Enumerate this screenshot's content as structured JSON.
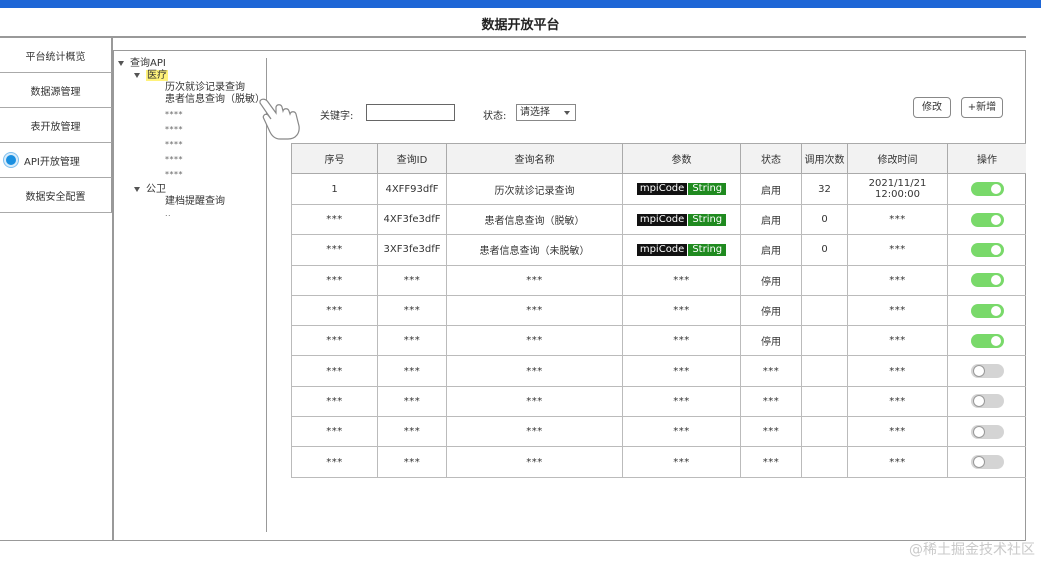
{
  "app": {
    "title": "数据开放平台"
  },
  "sidebar": {
    "items": [
      {
        "label": "平台统计概览",
        "active": false
      },
      {
        "label": "数据源管理",
        "active": false
      },
      {
        "label": "表开放管理",
        "active": false
      },
      {
        "label": "API开放管理",
        "active": true
      },
      {
        "label": "数据安全配置",
        "active": false
      }
    ]
  },
  "tree": {
    "root": "查询API",
    "group1": {
      "label": "医疗",
      "items": [
        "历次就诊记录查询",
        "患者信息查询（脱敏）",
        "****",
        "****",
        "****",
        "****",
        "****"
      ]
    },
    "group2": {
      "label": "公卫",
      "items": [
        "建档提醒查询",
        ".."
      ]
    }
  },
  "filters": {
    "keyword_label": "关键字:",
    "keyword_value": "",
    "status_label": "状态:",
    "status_value": "请选择"
  },
  "buttons": {
    "edit": "修改",
    "add": "+新增"
  },
  "table": {
    "headers": [
      "序号",
      "查询ID",
      "查询名称",
      "参数",
      "状态",
      "调用次数",
      "修改时间",
      "操作"
    ],
    "rows": [
      {
        "seq": "1",
        "id": "4XFF93dfF",
        "name": "历次就诊记录查询",
        "param_key": "mpiCode",
        "param_type": "String",
        "status": "启用",
        "calls": "32",
        "time": "2021/11/21 12:00:00",
        "enabled": true
      },
      {
        "seq": "***",
        "id": "4XF3fe3dfF",
        "name": "患者信息查询（脱敏）",
        "param_key": "mpiCode",
        "param_type": "String",
        "status": "启用",
        "calls": "0",
        "time": "***",
        "enabled": true
      },
      {
        "seq": "***",
        "id": "3XF3fe3dfF",
        "name": "患者信息查询（未脱敏）",
        "param_key": "mpiCode",
        "param_type": "String",
        "status": "启用",
        "calls": "0",
        "time": "***",
        "enabled": true
      },
      {
        "seq": "***",
        "id": "***",
        "name": "***",
        "param_key": "",
        "param_type": "",
        "param_text": "***",
        "status": "停用",
        "calls": "",
        "time": "***",
        "enabled": true
      },
      {
        "seq": "***",
        "id": "***",
        "name": "***",
        "param_key": "",
        "param_type": "",
        "param_text": "***",
        "status": "停用",
        "calls": "",
        "time": "***",
        "enabled": true
      },
      {
        "seq": "***",
        "id": "***",
        "name": "***",
        "param_key": "",
        "param_type": "",
        "param_text": "***",
        "status": "停用",
        "calls": "",
        "time": "***",
        "enabled": true
      },
      {
        "seq": "***",
        "id": "***",
        "name": "***",
        "param_key": "",
        "param_type": "",
        "param_text": "***",
        "status": "***",
        "calls": "",
        "time": "***",
        "enabled": false
      },
      {
        "seq": "***",
        "id": "***",
        "name": "***",
        "param_key": "",
        "param_type": "",
        "param_text": "***",
        "status": "***",
        "calls": "",
        "time": "***",
        "enabled": false
      },
      {
        "seq": "***",
        "id": "***",
        "name": "***",
        "param_key": "",
        "param_type": "",
        "param_text": "***",
        "status": "***",
        "calls": "",
        "time": "***",
        "enabled": false
      },
      {
        "seq": "***",
        "id": "***",
        "name": "***",
        "param_key": "",
        "param_type": "",
        "param_text": "***",
        "status": "***",
        "calls": "",
        "time": "***",
        "enabled": false
      }
    ]
  },
  "watermark": "@稀土掘金技术社区",
  "colors": {
    "topbar": "#1e66d6",
    "toggle_on": "#79d96a",
    "toggle_off": "#d4d4d4",
    "highlight": "#fff27a"
  }
}
